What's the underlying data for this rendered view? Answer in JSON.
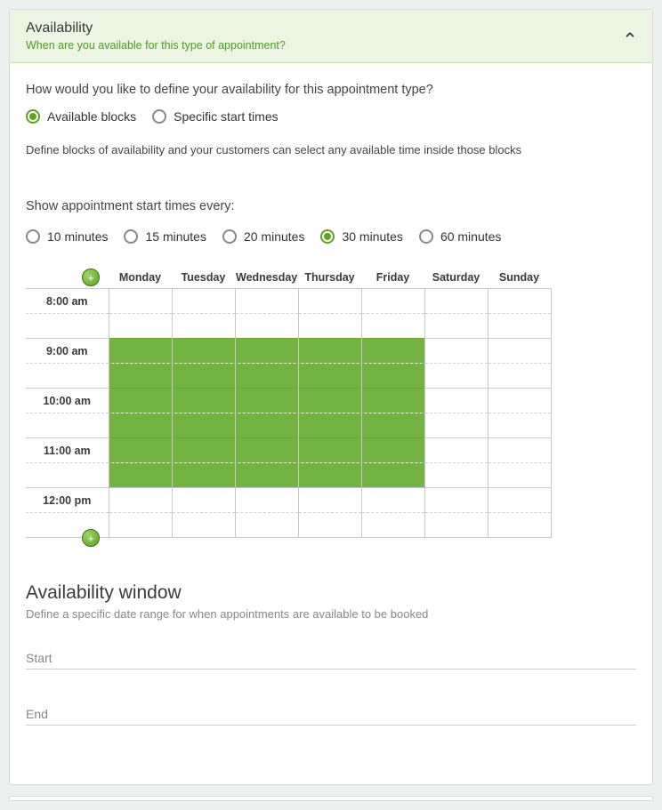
{
  "header": {
    "title": "Availability",
    "subtitle": "When are you available for this type of appointment?"
  },
  "question1": {
    "label": "How would you like to define your availability for this appointment type?",
    "options": [
      {
        "label": "Available blocks",
        "selected": true
      },
      {
        "label": "Specific start times",
        "selected": false
      }
    ],
    "description": "Define blocks of availability and your customers can select any available time inside those blocks"
  },
  "question2": {
    "label": "Show appointment start times every:",
    "options": [
      {
        "label": "10 minutes",
        "selected": false
      },
      {
        "label": "15 minutes",
        "selected": false
      },
      {
        "label": "20 minutes",
        "selected": false
      },
      {
        "label": "30 minutes",
        "selected": true
      },
      {
        "label": "60 minutes",
        "selected": false
      }
    ]
  },
  "schedule": {
    "days": [
      "Monday",
      "Tuesday",
      "Wednesday",
      "Thursday",
      "Friday",
      "Saturday",
      "Sunday"
    ],
    "rows": [
      {
        "label": "8:00 am",
        "hourStart": true,
        "avail": [
          false,
          false,
          false,
          false,
          false,
          false,
          false
        ]
      },
      {
        "label": "",
        "hourStart": false,
        "avail": [
          false,
          false,
          false,
          false,
          false,
          false,
          false
        ]
      },
      {
        "label": "9:00 am",
        "hourStart": true,
        "avail": [
          true,
          true,
          true,
          true,
          true,
          false,
          false
        ]
      },
      {
        "label": "",
        "hourStart": false,
        "avail": [
          true,
          true,
          true,
          true,
          true,
          false,
          false
        ]
      },
      {
        "label": "10:00 am",
        "hourStart": true,
        "avail": [
          true,
          true,
          true,
          true,
          true,
          false,
          false
        ]
      },
      {
        "label": "",
        "hourStart": false,
        "avail": [
          true,
          true,
          true,
          true,
          true,
          false,
          false
        ]
      },
      {
        "label": "11:00 am",
        "hourStart": true,
        "avail": [
          true,
          true,
          true,
          true,
          true,
          false,
          false
        ]
      },
      {
        "label": "",
        "hourStart": false,
        "avail": [
          true,
          true,
          true,
          true,
          true,
          false,
          false
        ]
      },
      {
        "label": "12:00 pm",
        "hourStart": true,
        "avail": [
          false,
          false,
          false,
          false,
          false,
          false,
          false
        ]
      },
      {
        "label": "",
        "hourStart": false,
        "avail": [
          false,
          false,
          false,
          false,
          false,
          false,
          false
        ]
      }
    ]
  },
  "window": {
    "title": "Availability window",
    "description": "Define a specific date range for when appointments are available to be booked",
    "fields": [
      {
        "label": "Start"
      },
      {
        "label": "End"
      }
    ]
  }
}
